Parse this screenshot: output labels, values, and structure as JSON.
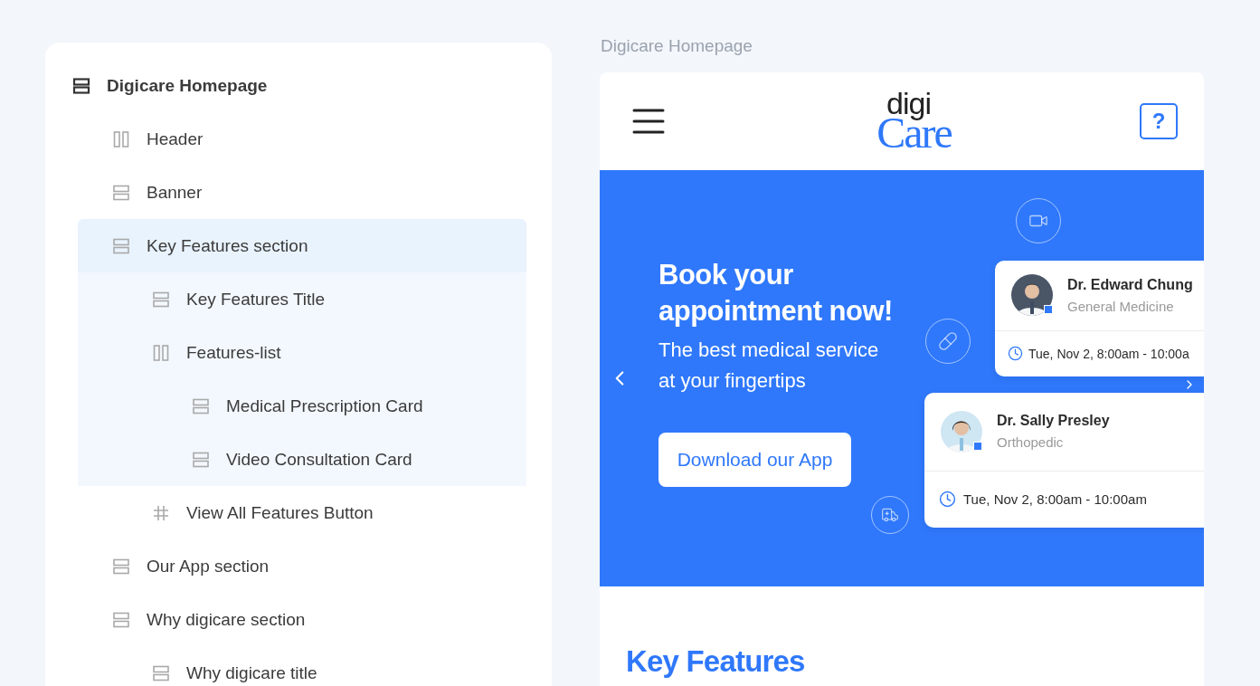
{
  "tree": {
    "label": "Digicare Homepage",
    "kind": "rows",
    "selected": false,
    "highlighted": false,
    "children": [
      {
        "label": "Header",
        "kind": "columns",
        "selected": false,
        "highlighted": false
      },
      {
        "label": "Banner",
        "kind": "rows",
        "selected": false,
        "highlighted": false
      },
      {
        "label": "Key Features section",
        "kind": "rows",
        "selected": true,
        "highlighted": true,
        "children": [
          {
            "label": "Key Features Title",
            "kind": "rows",
            "selected": false,
            "highlighted": true
          },
          {
            "label": "Features-list",
            "kind": "columns",
            "selected": false,
            "highlighted": true,
            "children": [
              {
                "label": "Medical Prescription Card",
                "kind": "rows",
                "selected": false,
                "highlighted": true
              },
              {
                "label": "Video Consultation Card",
                "kind": "rows",
                "selected": false,
                "highlighted": true
              }
            ]
          },
          {
            "label": "View All Features Button",
            "kind": "grid",
            "selected": false,
            "highlighted": false
          }
        ]
      },
      {
        "label": "Our App section",
        "kind": "rows",
        "selected": false,
        "highlighted": false
      },
      {
        "label": "Why digicare section",
        "kind": "rows",
        "selected": false,
        "highlighted": false,
        "children": [
          {
            "label": "Why digicare title",
            "kind": "rows",
            "selected": false,
            "highlighted": false
          }
        ]
      }
    ]
  },
  "preview": {
    "title": "Digicare Homepage",
    "logo": {
      "top": "digi",
      "bottom": "Care"
    },
    "help": "?",
    "banner": {
      "heading": "Book your appointment now!",
      "subheading": "The best medical service at your fingertips",
      "button": "Download our App",
      "doctors": [
        {
          "name": "Dr. Edward Chung",
          "specialty": "General Medicine",
          "time": "Tue, Nov 2, 8:00am - 10:00a"
        },
        {
          "name": "Dr. Sally Presley",
          "specialty": "Orthopedic",
          "time": "Tue, Nov 2, 8:00am - 10:00am"
        }
      ]
    },
    "section_title": "Key Features"
  }
}
